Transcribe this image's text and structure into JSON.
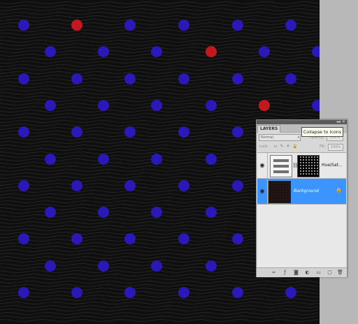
{
  "canvas": {
    "background": "#0f0f0f",
    "dot_blue": "#2a18b8",
    "dot_red": "#c41820"
  },
  "layers_panel": {
    "tab_label": "LAYERS",
    "panel_controls": "◂◂ ✕",
    "tooltip": "Collapse to Icons",
    "blend_mode": "Normal",
    "opacity_label": "Opacity:",
    "opacity_value": "100%",
    "lock_label": "Lock:",
    "fill_label": "Fill:",
    "fill_value": "100%",
    "layers": [
      {
        "name": "Hue/Sat...",
        "visible": true,
        "selected": false
      },
      {
        "name": "Background",
        "visible": true,
        "selected": true,
        "locked": true
      }
    ],
    "colors": {
      "selected_row": "#3b94ff",
      "panel_bg": "#d8d8d8"
    }
  }
}
